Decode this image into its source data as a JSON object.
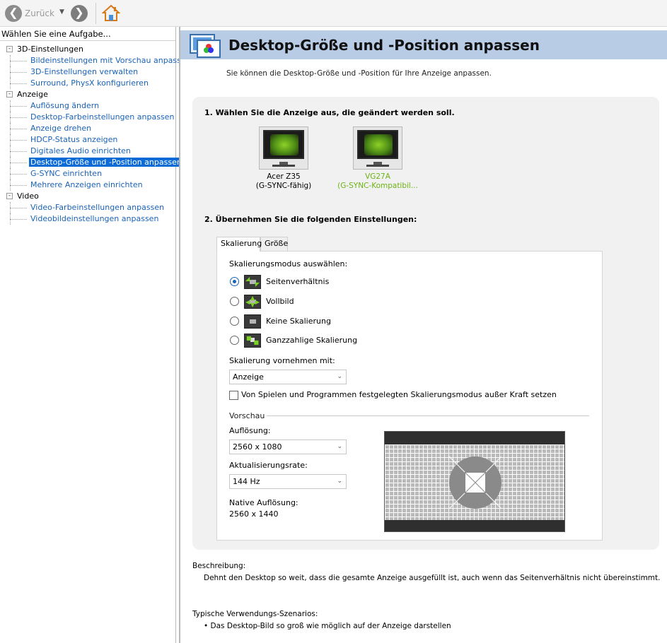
{
  "toolbar": {
    "back_label": "Zurück",
    "icons": {
      "back": "back-arrow-icon",
      "forward": "forward-arrow-icon",
      "home": "home-icon"
    }
  },
  "sidebar": {
    "header": "Wählen Sie eine Aufgabe...",
    "categories": [
      {
        "label": "3D-Einstellungen",
        "items": [
          "Bildeinstellungen mit Vorschau anpassen",
          "3D-Einstellungen verwalten",
          "Surround, PhysX konfigurieren"
        ]
      },
      {
        "label": "Anzeige",
        "items": [
          "Auflösung ändern",
          "Desktop-Farbeinstellungen anpassen",
          "Anzeige drehen",
          "HDCP-Status anzeigen",
          "Digitales Audio einrichten",
          "Desktop-Größe und -Position anpassen",
          "G-SYNC einrichten",
          "Mehrere Anzeigen einrichten"
        ]
      },
      {
        "label": "Video",
        "items": [
          "Video-Farbeinstellungen anpassen",
          "Videobildeinstellungen anpassen"
        ]
      }
    ],
    "selected": "Desktop-Größe und -Position anpassen"
  },
  "main": {
    "title": "Desktop-Größe und -Position anpassen",
    "intro": "Sie können die Desktop-Größe und -Position für Ihre Anzeige anpassen.",
    "step1": "1. Wählen Sie die Anzeige aus, die geändert werden soll.",
    "displays": [
      {
        "name": "Acer Z35",
        "sub": "(G-SYNC-fähig)"
      },
      {
        "name": "VG27A",
        "sub": "(G-SYNC-Kompatibil..."
      }
    ],
    "step2": "2. Übernehmen Sie die folgenden Einstellungen:",
    "tabs": [
      {
        "label": "Skalierung"
      },
      {
        "label": "Größe"
      }
    ],
    "scaling": {
      "mode_label": "Skalierungsmodus auswählen:",
      "modes": [
        {
          "label": "Seitenverhältnis",
          "checked": true
        },
        {
          "label": "Vollbild",
          "checked": false
        },
        {
          "label": "Keine Skalierung",
          "checked": false
        },
        {
          "label": "Ganzzahlige Skalierung",
          "checked": false
        }
      ],
      "perform_label": "Skalierung vornehmen mit:",
      "perform_value": "Anzeige",
      "override_label": "Von Spielen und Programmen festgelegten Skalierungsmodus außer Kraft setzen",
      "override_checked": false
    },
    "preview": {
      "label": "Vorschau",
      "res_label": "Auflösung:",
      "res_value": "2560 x 1080",
      "rate_label": "Aktualisierungsrate:",
      "rate_value": "144 Hz",
      "native_label": "Native Auflösung:",
      "native_value": "2560 x 1440"
    },
    "description": {
      "heading": "Beschreibung:",
      "text": "Dehnt den Desktop so weit, dass die gesamte Anzeige ausgefüllt ist, auch wenn das Seitenverhältnis nicht übereinstimmt."
    },
    "usage": {
      "heading": "Typische Verwendungs-Szenarios:",
      "items": [
        "• Das Desktop-Bild so groß wie möglich auf der Anzeige darstellen"
      ]
    }
  },
  "colors": {
    "link": "#1a62b7",
    "selected_bg": "#0a6ad6",
    "banner": "#b9cce6",
    "active_display": "#6cb313"
  }
}
